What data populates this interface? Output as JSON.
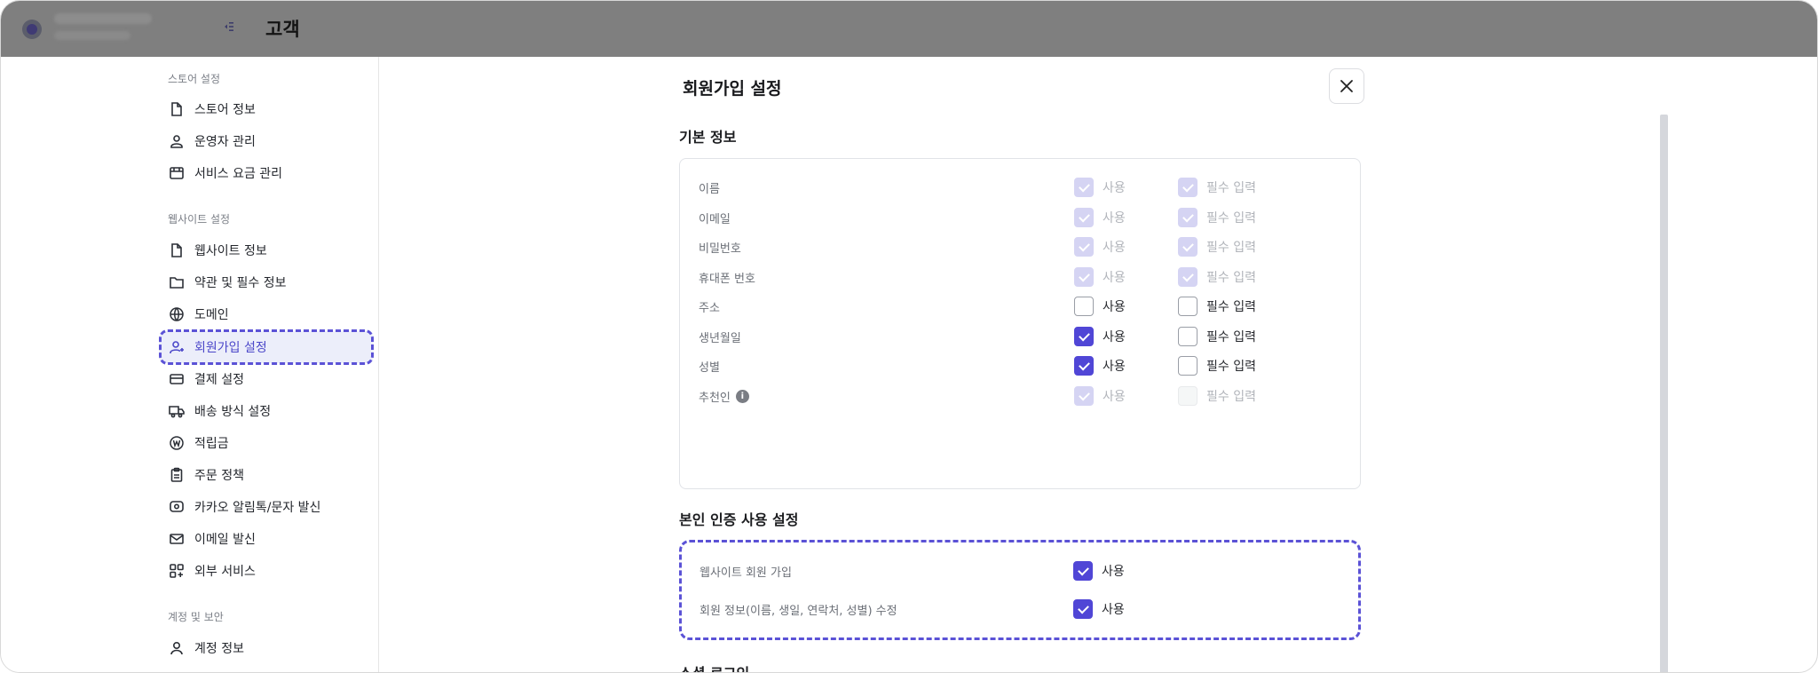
{
  "header": {
    "title": "고객"
  },
  "sidebar": {
    "sections": [
      {
        "label": "스토어 설정",
        "items": [
          "스토어 정보",
          "운영자 관리",
          "서비스 요금 관리"
        ]
      },
      {
        "label": "웹사이트 설정",
        "items": [
          "웹사이트 정보",
          "약관 및 필수 정보",
          "도메인",
          "회원가입 설정",
          "결제 설정",
          "배송 방식 설정",
          "적립금",
          "주문 정책",
          "카카오 알림톡/문자 발신",
          "이메일 발신",
          "외부 서비스"
        ]
      },
      {
        "label": "계정 및 보안",
        "items": [
          "계정 정보"
        ]
      }
    ],
    "active_item": "회원가입 설정"
  },
  "modal": {
    "title": "회원가입 설정",
    "use_label": "사용",
    "required_label": "필수 입력",
    "basic_info": {
      "title": "기본 정보",
      "rows": [
        {
          "field": "이름",
          "use": "checked-disabled",
          "required": "checked-disabled"
        },
        {
          "field": "이메일",
          "use": "checked-disabled",
          "required": "checked-disabled"
        },
        {
          "field": "비밀번호",
          "use": "checked-disabled",
          "required": "checked-disabled"
        },
        {
          "field": "휴대폰 번호",
          "use": "checked-disabled",
          "required": "checked-disabled"
        },
        {
          "field": "주소",
          "use": "unchecked",
          "required": "unchecked"
        },
        {
          "field": "생년월일",
          "use": "checked",
          "required": "unchecked"
        },
        {
          "field": "성별",
          "use": "checked",
          "required": "unchecked"
        },
        {
          "field": "추천인",
          "use": "checked-disabled",
          "required": "unchecked-disabled",
          "has_info_icon": true
        }
      ]
    },
    "verification": {
      "title": "본인 인증 사용 설정",
      "rows": [
        {
          "field": "웹사이트 회원 가입",
          "use": "checked"
        },
        {
          "field": "회원 정보(이름, 생일, 연락처, 성별) 수정",
          "use": "checked"
        }
      ]
    },
    "next_section_title": "소셜 로그인"
  },
  "colors": {
    "accent": "#5046d6",
    "highlight_outline": "#5b52d6",
    "overlay": "#7f7f7f"
  }
}
